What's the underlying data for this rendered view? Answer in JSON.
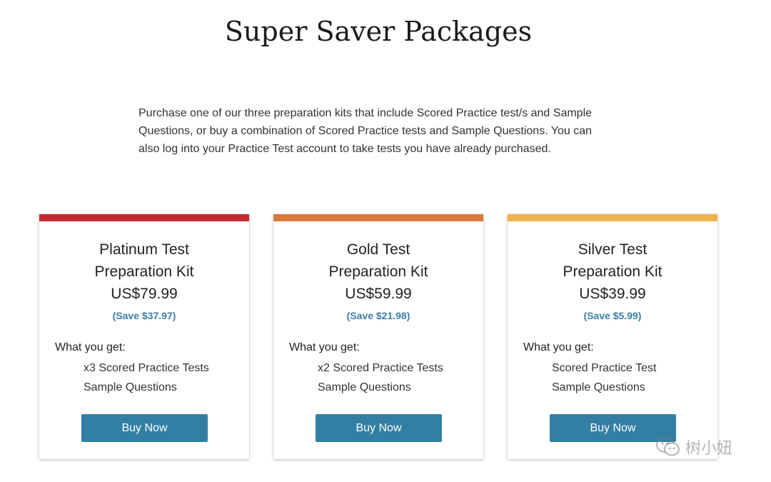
{
  "page": {
    "title": "Super Saver Packages",
    "intro": "Purchase one of our three preparation kits that include Scored Practice test/s and Sample Questions, or buy a combination of Scored Practice tests and Sample Questions. You can also log into your Practice Test account to take tests you have already purchased."
  },
  "cards": [
    {
      "title_line1": "Platinum Test",
      "title_line2": "Preparation Kit",
      "price": "US$79.99",
      "save": "(Save $37.97)",
      "what_label": "What you get:",
      "items": [
        "x3 Scored Practice Tests",
        "Sample Questions"
      ],
      "button": "Buy Now",
      "accent": "#c62a2f"
    },
    {
      "title_line1": "Gold Test",
      "title_line2": "Preparation Kit",
      "price": "US$59.99",
      "save": "(Save $21.98)",
      "what_label": "What you get:",
      "items": [
        "x2 Scored Practice Tests",
        "Sample Questions"
      ],
      "button": "Buy Now",
      "accent": "#d9793a"
    },
    {
      "title_line1": "Silver Test",
      "title_line2": "Preparation Kit",
      "price": "US$39.99",
      "save": "(Save $5.99)",
      "what_label": "What you get:",
      "items": [
        "Scored Practice Test",
        "Sample Questions"
      ],
      "button": "Buy Now",
      "accent": "#f0b24d"
    }
  ],
  "colors": {
    "button": "#337fa3",
    "save_text": "#3a7ea8"
  },
  "watermark": {
    "icon": "wechat-icon",
    "text": "树小妞"
  }
}
